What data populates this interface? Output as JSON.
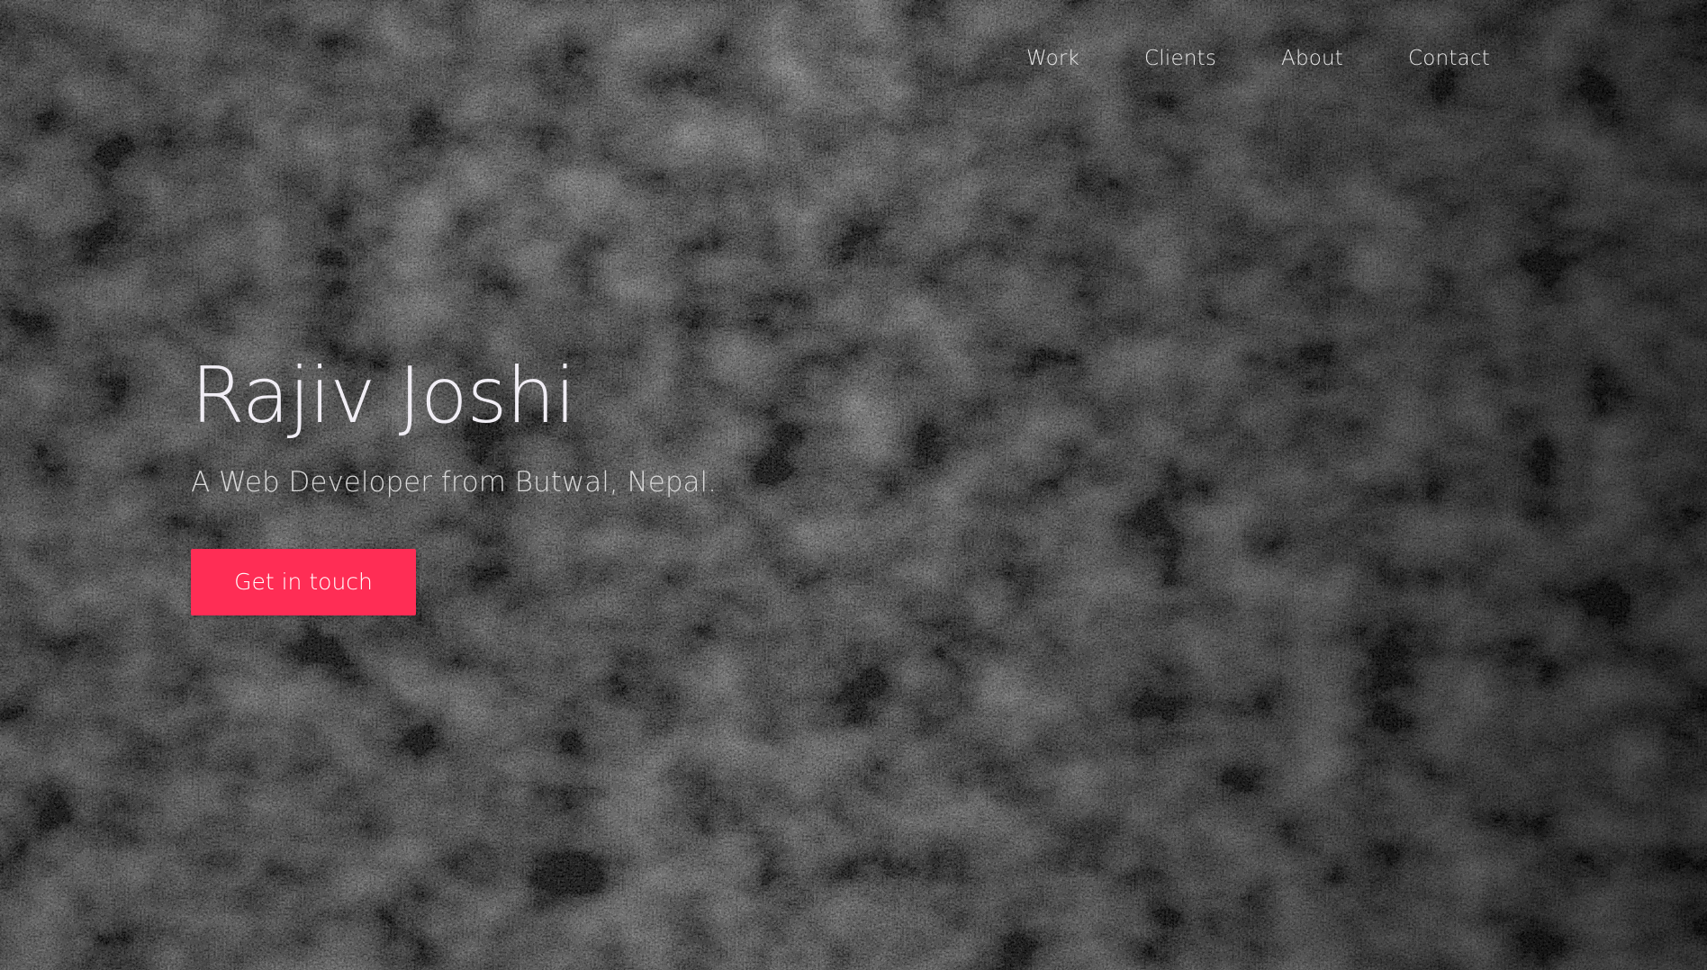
{
  "nav": {
    "items": [
      {
        "label": "Work"
      },
      {
        "label": "Clients"
      },
      {
        "label": "About"
      },
      {
        "label": "Contact"
      }
    ]
  },
  "hero": {
    "title": "Rajiv Joshi",
    "subtitle": "A Web Developer from Butwal, Nepal.",
    "cta_label": "Get in touch"
  },
  "colors": {
    "accent": "#ff2d55",
    "title_text": "#f1eef5",
    "body_text": "#d9d9d9"
  }
}
